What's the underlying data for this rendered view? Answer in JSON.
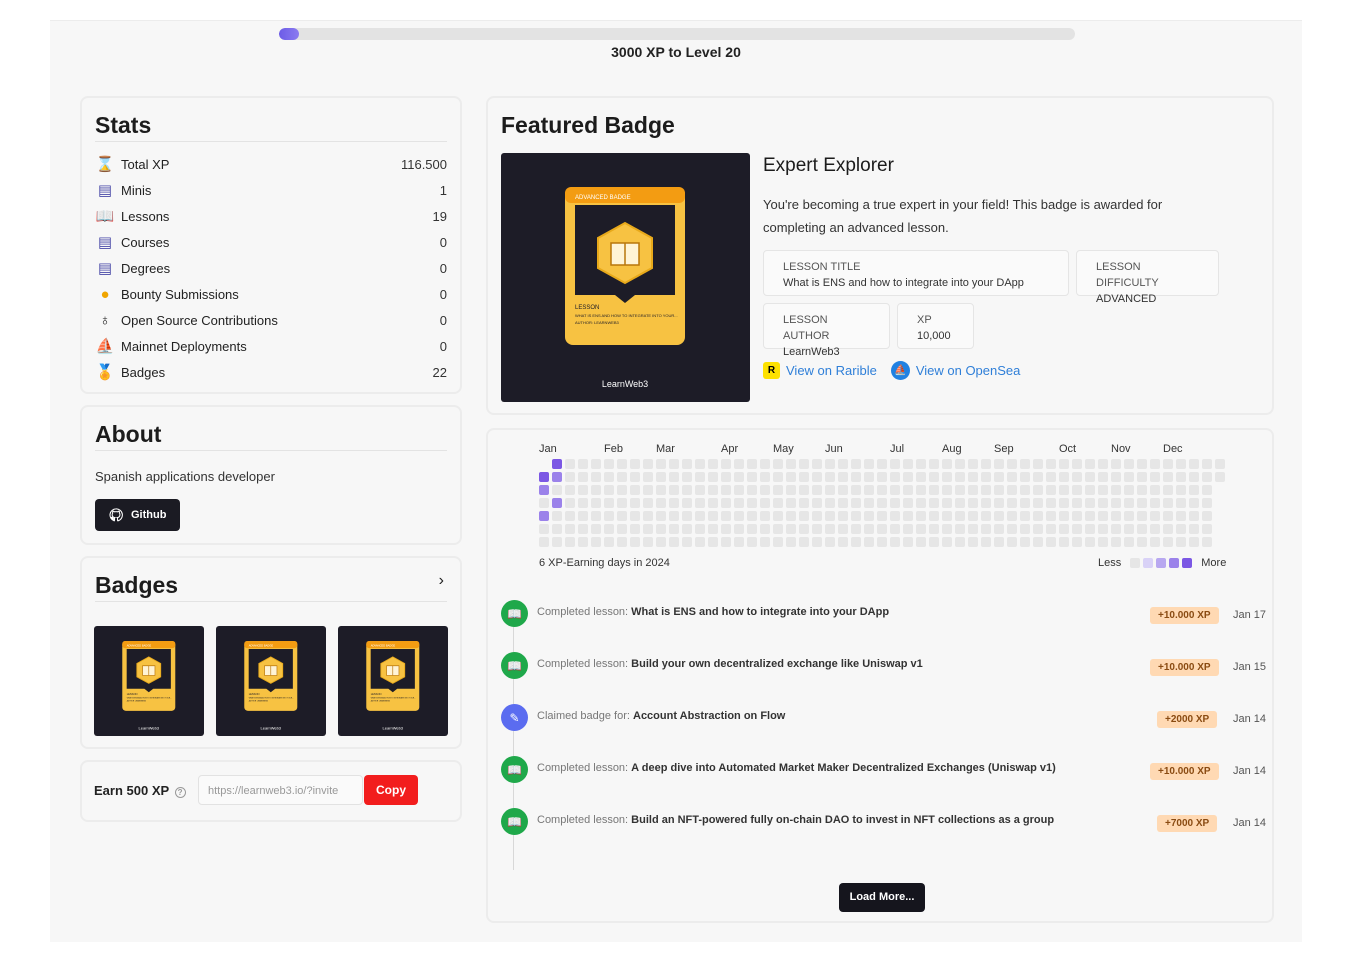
{
  "progress": {
    "label": "3000 XP to Level 20",
    "fraction": 0.025,
    "color": "#6c5ce7"
  },
  "stats": {
    "title": "Stats",
    "rows": [
      {
        "icon": "trophy-icon",
        "label": "Total XP",
        "value": "116.500"
      },
      {
        "icon": "minis-icon",
        "label": "Minis",
        "value": "1"
      },
      {
        "icon": "book-icon",
        "label": "Lessons",
        "value": "19"
      },
      {
        "icon": "course-icon",
        "label": "Courses",
        "value": "0"
      },
      {
        "icon": "degree-icon",
        "label": "Degrees",
        "value": "0"
      },
      {
        "icon": "bounty-icon",
        "label": "Bounty Submissions",
        "value": "0"
      },
      {
        "icon": "open-source-icon",
        "label": "Open Source Contributions",
        "value": "0"
      },
      {
        "icon": "ship-icon",
        "label": "Mainnet Deployments",
        "value": "0"
      },
      {
        "icon": "medal-icon",
        "label": "Badges",
        "value": "22"
      }
    ]
  },
  "about": {
    "title": "About",
    "text": "Spanish applications developer",
    "github_label": "Github"
  },
  "badges": {
    "title": "Badges"
  },
  "badge_art": {
    "top_label": "ADVANCED BADGE",
    "lesson_label": "LESSON",
    "lesson_text": "WHAT IS ENS AND HOW TO INTEGRATE INTO YOUR...",
    "author_text": "AUTHOR: LEARNWEB3",
    "brand": "LearnWeb3"
  },
  "earn": {
    "label": "Earn 500 XP",
    "url": "https://learnweb3.io/?invite",
    "copy_label": "Copy"
  },
  "featured": {
    "title": "Featured Badge",
    "badge_name": "Expert Explorer",
    "description": "You're becoming a true expert in your field! This badge is awarded for completing an advanced lesson.",
    "lesson_title_key": "LESSON TITLE",
    "lesson_title": "What is ENS and how to integrate into your DApp",
    "difficulty_key": "LESSON DIFFICULTY",
    "difficulty": "ADVANCED",
    "author_key": "LESSON AUTHOR",
    "author": "LearnWeb3",
    "xp_key": "XP",
    "xp": "10,000",
    "rarible_label": "View on Rarible",
    "opensea_label": "View on OpenSea"
  },
  "activity": {
    "months": [
      "Jan",
      "Feb",
      "Mar",
      "Apr",
      "May",
      "Jun",
      "Jul",
      "Aug",
      "Sep",
      "Oct",
      "Nov",
      "Dec"
    ],
    "summary": "6 XP-Earning days in 2024",
    "legend_less": "Less",
    "legend_more": "More",
    "active_days": [
      {
        "week": 1,
        "day": 0,
        "level": 4
      },
      {
        "week": 0,
        "day": 1,
        "level": 4
      },
      {
        "week": 1,
        "day": 1,
        "level": 3
      },
      {
        "week": 0,
        "day": 2,
        "level": 3
      },
      {
        "week": 1,
        "day": 3,
        "level": 3
      },
      {
        "week": 0,
        "day": 4,
        "level": 3
      }
    ],
    "level_colors": [
      "#e6e6e6",
      "#d9d2f7",
      "#b8a8f0",
      "#9b82ea",
      "#7b57e4"
    ],
    "events": [
      {
        "icon": "book-icon",
        "color": "#1fa84a",
        "prefix": "Completed lesson: ",
        "name": "What is ENS and how to integrate into your DApp",
        "xp": "+10.000 XP",
        "date": "Jan 17"
      },
      {
        "icon": "book-icon",
        "color": "#1fa84a",
        "prefix": "Completed lesson: ",
        "name": "Build your own decentralized exchange like Uniswap v1",
        "xp": "+10.000 XP",
        "date": "Jan 15"
      },
      {
        "icon": "pencil-icon",
        "color": "#5b6cf0",
        "prefix": "Claimed badge for: ",
        "name": "Account Abstraction on Flow",
        "xp": "+2000 XP",
        "date": "Jan 14"
      },
      {
        "icon": "book-icon",
        "color": "#1fa84a",
        "prefix": "Completed lesson: ",
        "name": "A deep dive into Automated Market Maker Decentralized Exchanges (Uniswap v1)",
        "xp": "+10.000 XP",
        "date": "Jan 14"
      },
      {
        "icon": "book-icon",
        "color": "#1fa84a",
        "prefix": "Completed lesson: ",
        "name": "Build an NFT-powered fully on-chain DAO to invest in NFT collections as a group",
        "xp": "+7000 XP",
        "date": "Jan 14"
      }
    ],
    "load_more": "Load More..."
  }
}
